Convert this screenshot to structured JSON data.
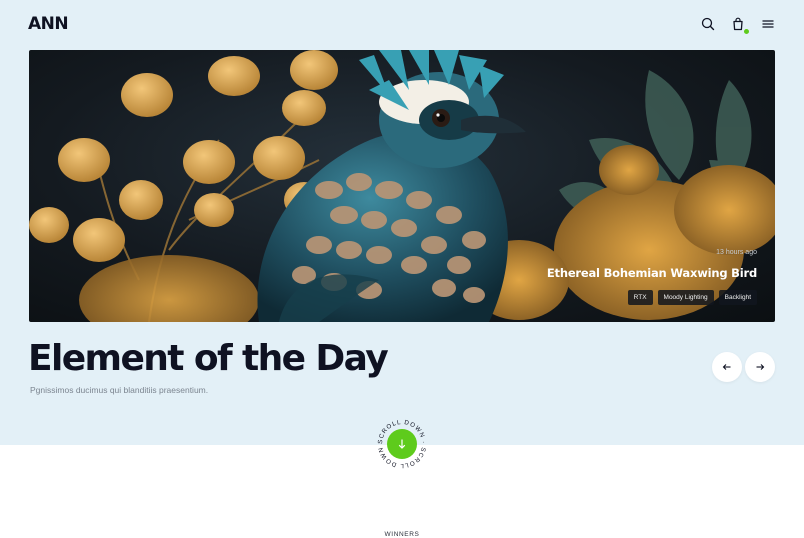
{
  "header": {
    "logo_text": "ANN",
    "icons": [
      "search-icon",
      "shopping-bag-icon",
      "menu-icon"
    ],
    "cart_indicator_color": "#5ecb1c"
  },
  "hero": {
    "time_ago": "13 hours ago",
    "item_title": "Ethereal Bohemian Waxwing Bird",
    "tags": [
      "RTX",
      "Moody Lighting",
      "Backlight"
    ],
    "headline": "Element of the Day",
    "subline": "Pgnissimos ducimus qui blanditiis praesentium.",
    "prev_icon": "arrow-left-icon",
    "next_icon": "arrow-right-icon"
  },
  "scroll": {
    "ring_text": "SCROLL DOWN · SCROLL DOWN ·",
    "icon": "arrow-down-icon"
  },
  "section": {
    "label": "WINNERS"
  },
  "colors": {
    "hero_background": "#e3f0f7",
    "accent": "#5ecb1c",
    "text_dark": "#0f1222"
  }
}
